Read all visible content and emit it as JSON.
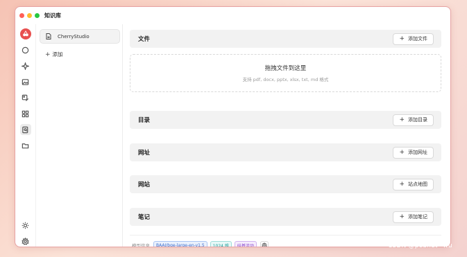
{
  "window": {
    "title": "知识库"
  },
  "knowledge_bases": {
    "items": [
      {
        "label": "CherryStudio"
      }
    ],
    "add_label": "添加"
  },
  "sections": {
    "files": {
      "title": "文件",
      "button": "添加文件"
    },
    "dropzone": {
      "title": "拖拽文件到这里",
      "subtitle": "支持 pdf, docx, pptx, xlsx, txt, md 格式"
    },
    "directory": {
      "title": "目录",
      "button": "添加目录"
    },
    "url": {
      "title": "网址",
      "button": "添加网址"
    },
    "website": {
      "title": "网站",
      "button": "站点地图"
    },
    "notes": {
      "title": "笔记",
      "button": "添加笔记"
    }
  },
  "model_info": {
    "label": "模型信息",
    "model": "BAAI/bge-large-en-v1.5",
    "dimensions": "1024 维",
    "status": "硅基流动"
  },
  "watermark": "CSDN @peanut~wu",
  "colors": {
    "accent": "#e8504f",
    "section_bg": "#f2f2f2"
  }
}
